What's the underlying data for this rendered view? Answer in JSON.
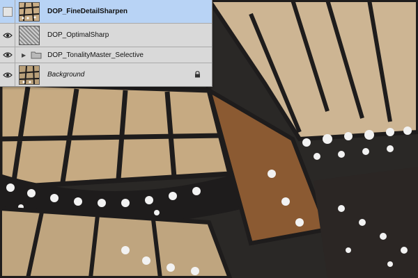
{
  "layers_panel": {
    "layers": [
      {
        "name": "DOP_FineDetailSharpen",
        "visible": false,
        "selected": true,
        "type": "layer",
        "thumbnail": "butterfly-thumbnail"
      },
      {
        "name": "DOP_OptimalSharp",
        "visible": true,
        "selected": false,
        "type": "layer",
        "thumbnail": "noise-thumbnail"
      },
      {
        "name": "DOP_TonalityMaster_Selective",
        "visible": true,
        "selected": false,
        "type": "group",
        "icon": "folder-icon",
        "expanded": false
      },
      {
        "name": "Background",
        "visible": true,
        "selected": false,
        "type": "layer",
        "thumbnail": "butterfly-thumbnail",
        "locked": true,
        "italic": true
      }
    ]
  },
  "canvas": {
    "subject": "monarch-butterfly-wings",
    "colors": {
      "wing_tan": "#c9ad86",
      "vein_black": "#1e1c1c",
      "spot_white": "#f2f2f2",
      "orange": "#b06a30"
    }
  }
}
